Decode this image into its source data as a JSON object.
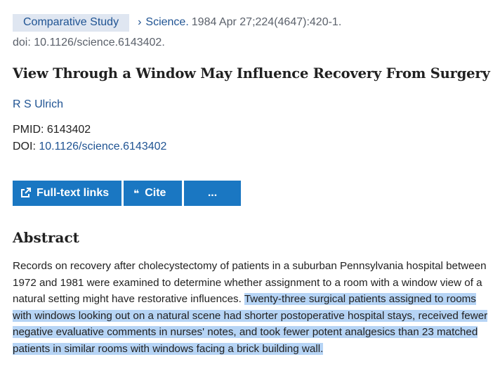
{
  "header": {
    "badge": "Comparative Study",
    "journal": "Science.",
    "citation": "1984 Apr 27;224(4647):420-1.",
    "doi_line": "doi: 10.1126/science.6143402."
  },
  "article": {
    "title": "View Through a Window May Influence Recovery From Surgery",
    "author": "R S Ulrich",
    "pmid_label": "PMID:",
    "pmid_value": "6143402",
    "doi_label": "DOI:",
    "doi_value": "10.1126/science.6143402"
  },
  "actions": {
    "full_text": "Full-text links",
    "cite": "Cite",
    "more": "..."
  },
  "abstract": {
    "heading": "Abstract",
    "text_plain": "Records on recovery after cholecystectomy of patients in a suburban Pennsylvania hospital between 1972 and 1981 were examined to determine whether assignment to a room with a window view of a natural setting might have restorative influences. ",
    "text_highlighted": "Twenty-three surgical patients assigned to rooms with windows looking out on a natural scene had shorter postoperative hospital stays, received fewer negative evaluative comments in nurses' notes, and took fewer potent analgesics than 23 matched patients in similar rooms with windows facing a brick building wall."
  }
}
